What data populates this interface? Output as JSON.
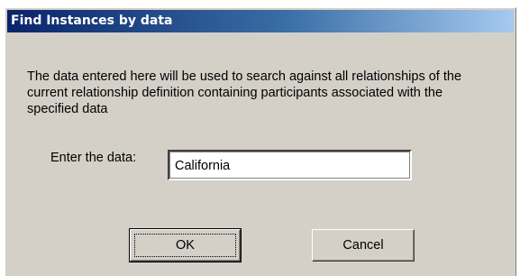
{
  "dialog": {
    "title": "Find Instances by data",
    "description": "The data entered here will be used to search against all relationships of the current relationship definition containing participants associated with the specified data",
    "field_label": "Enter the data:",
    "field_value": "California",
    "ok_label": "OK",
    "cancel_label": "Cancel"
  },
  "colors": {
    "titlebar_start": "#0a246a",
    "titlebar_end": "#a6caf0",
    "dialog_background": "#d4d0c8"
  }
}
